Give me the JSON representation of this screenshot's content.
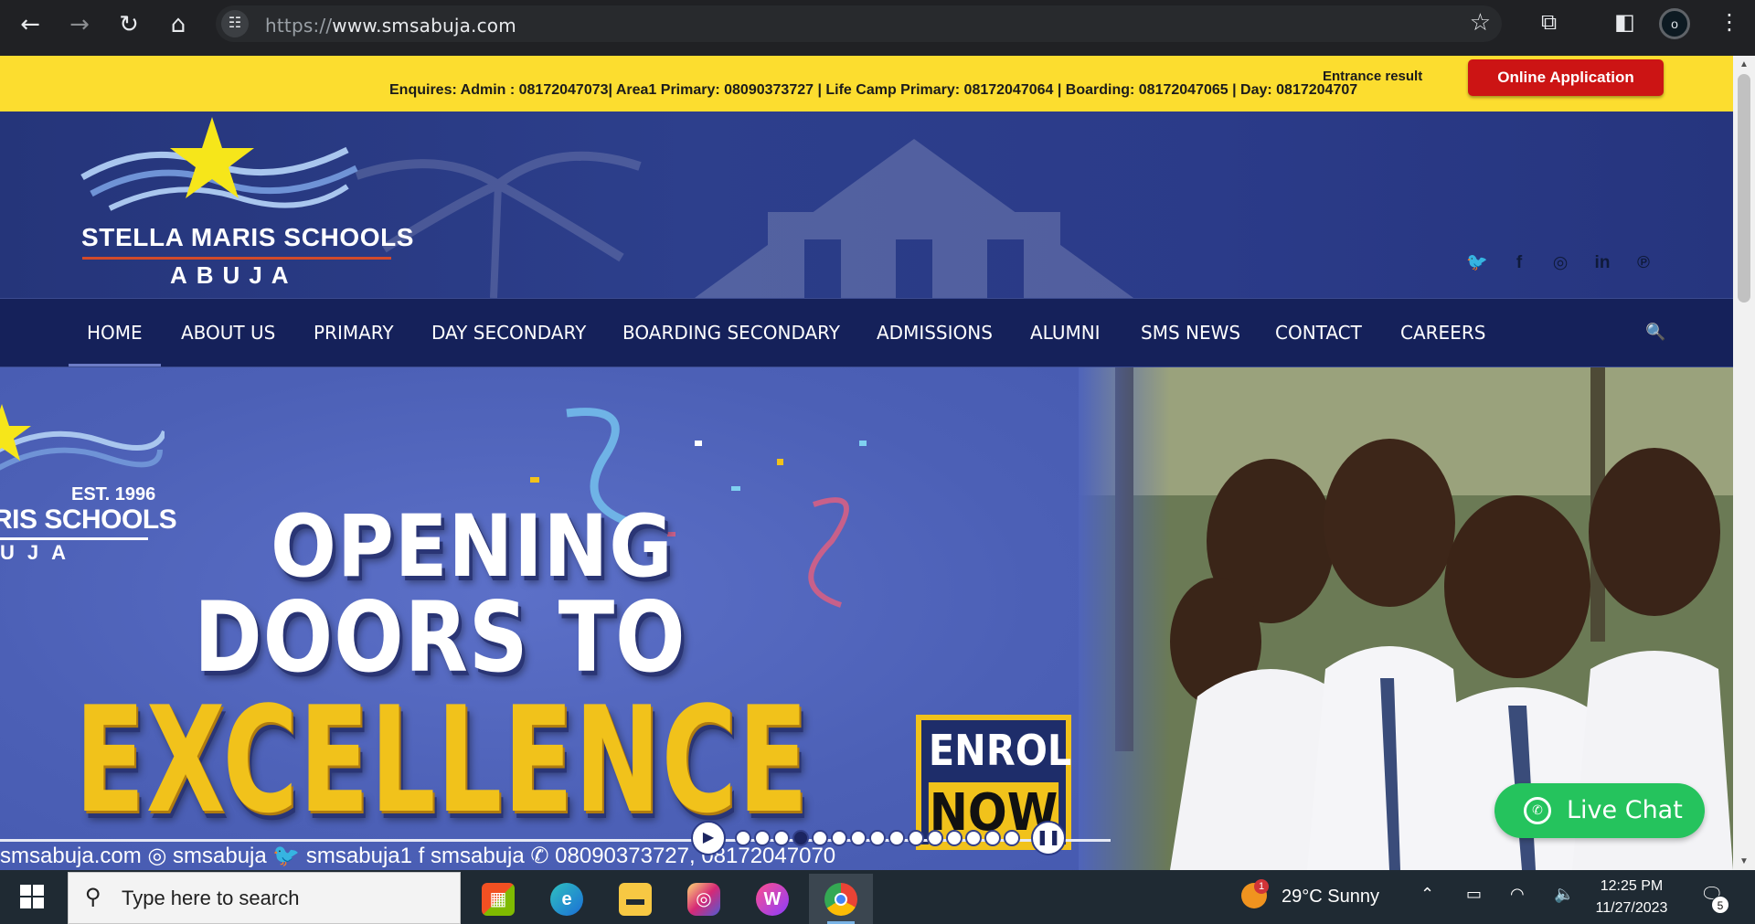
{
  "browser": {
    "url_scheme": "https://",
    "url_host": "www.smsabuja.com",
    "profile_initial": "o",
    "icons": {
      "back": "←",
      "forward": "→",
      "reload": "↻",
      "home": "⌂",
      "tune": "☷",
      "star": "☆",
      "extensions": "⧉",
      "side_panel": "◧",
      "menu": "⋮"
    }
  },
  "topbar": {
    "enquiries": "Enquires: Admin : 08172047073| Area1 Primary: 08090373727 | Life Camp Primary: 08172047064 | Boarding: 08172047065 | Day: 0817204707",
    "entrance_result": "Entrance result",
    "online_application": "Online Application",
    "accent": "#fcdd2f",
    "button_color": "#cc1414"
  },
  "header": {
    "school_name": "STELLA MARIS SCHOOLS",
    "city": "ABUJA",
    "social": [
      "twitter-icon",
      "facebook-icon",
      "instagram-icon",
      "linkedin-icon",
      "pinterest-icon"
    ],
    "social_glyphs": [
      "🐦",
      "f",
      "◎",
      "in",
      "℗"
    ]
  },
  "nav": {
    "items": [
      "HOME",
      "ABOUT US",
      "PRIMARY",
      "DAY SECONDARY",
      "BOARDING SECONDARY",
      "ADMISSIONS",
      "ALUMNI",
      "SMS NEWS",
      "CONTACT",
      "CAREERS"
    ],
    "active": "HOME",
    "search_glyph": "🔍",
    "bg_color": "#15215a"
  },
  "hero": {
    "est": "EST. 1996",
    "logo_name": "RIS SCHOOLS",
    "logo_city": "UJA",
    "headline_line1": "OPENING",
    "headline_line2": "DOORS TO",
    "headline_line3": "EXCELLENCE",
    "enrol": "ENROL",
    "now": "NOW",
    "footer_text": "smsabuja.com    ◎ smsabuja     🐦 smsabuja1     f smsabuja     ✆ 08090373727, 08172047070",
    "slider": {
      "play": "▶",
      "pause": "❚❚",
      "dot_count": 15,
      "active_dot": 3
    }
  },
  "live_chat": {
    "label": "Live Chat",
    "icon": "whatsapp-icon",
    "color": "#25c35d"
  },
  "taskbar": {
    "search_placeholder": "Type here to search",
    "apps": [
      "microsoft-store-icon",
      "edge-icon",
      "file-explorer-icon",
      "instagram-icon",
      "wps-office-icon",
      "chrome-icon"
    ],
    "weather": "29°C  Sunny",
    "weather_badge": "1",
    "time": "12:25 PM",
    "date": "11/27/2023",
    "notifications": "5",
    "tray_glyphs": {
      "chevron": "⌃",
      "battery": "▭",
      "network": "◠",
      "volume": "🔈",
      "notif": "🗨"
    }
  }
}
